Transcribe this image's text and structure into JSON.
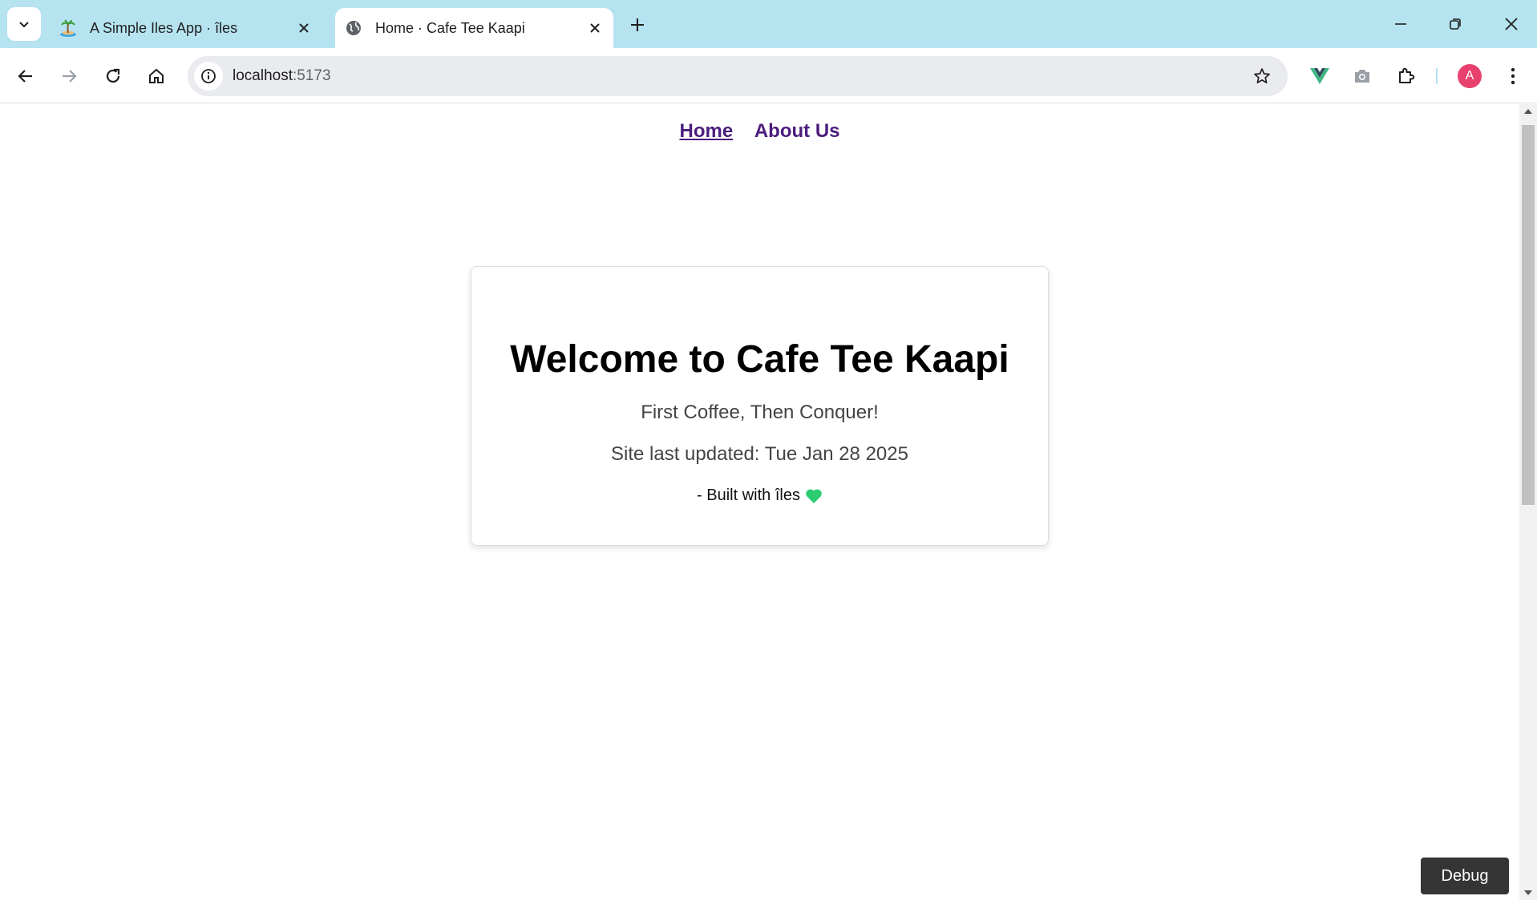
{
  "browser": {
    "tabs": [
      {
        "title": "A Simple Iles App · îles",
        "favicon": "island-emoji-icon",
        "active": false
      },
      {
        "title": "Home · Cafe Tee Kaapi",
        "favicon": "globe-icon",
        "active": true
      }
    ],
    "address": {
      "host": "localhost",
      "port": ":5173"
    },
    "profile_initial": "A",
    "colors": {
      "frame": "#b5e4f0",
      "avatar": "#e8416f"
    }
  },
  "page": {
    "nav": {
      "home_label": "Home",
      "about_label": "About Us"
    },
    "card": {
      "heading": "Welcome to Cafe Tee Kaapi",
      "tagline": "First Coffee, Then Conquer!",
      "updated": "Site last updated: Tue Jan 28 2025",
      "built_with": "- Built with îles"
    },
    "debug_label": "Debug",
    "colors": {
      "nav_link": "#4b1d7d",
      "heart": "#2ecc71"
    }
  }
}
